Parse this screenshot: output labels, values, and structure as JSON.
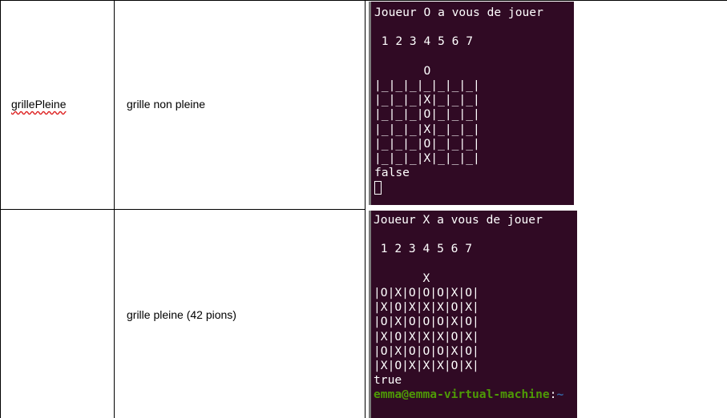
{
  "rows": [
    {
      "function_name": "grillePleine",
      "case_description": "grille non pleine",
      "terminal": {
        "lines": [
          "Joueur O a vous de jouer",
          "",
          " 1 2 3 4 5 6 7",
          "",
          "       O",
          "|_|_|_|_|_|_|_|",
          "|_|_|_|X|_|_|_|",
          "|_|_|_|O|_|_|_|",
          "|_|_|_|X|_|_|_|",
          "|_|_|_|O|_|_|_|",
          "|_|_|_|X|_|_|_|",
          "false"
        ],
        "show_cursor": true
      }
    },
    {
      "function_name": "",
      "case_description": "grille pleine (42 pions)",
      "terminal": {
        "lines": [
          "Joueur X a vous de jouer",
          "",
          " 1 2 3 4 5 6 7",
          "",
          "       X",
          "|O|X|O|O|O|X|O|",
          "|X|O|X|X|X|O|X|",
          "|O|X|O|O|O|X|O|",
          "|X|O|X|X|X|O|X|",
          "|O|X|O|O|O|X|O|",
          "|X|O|X|X|X|O|X|",
          "true"
        ],
        "prompt_user": "emma@emma-virtual-machine",
        "prompt_sep": ":",
        "prompt_path": "~"
      }
    }
  ],
  "colors": {
    "terminal_bg": "#300a24",
    "terminal_fg": "#ffffff",
    "prompt_user": "#4e9a06",
    "prompt_path": "#3465a4",
    "spellcheck_underline": "#d22222"
  }
}
